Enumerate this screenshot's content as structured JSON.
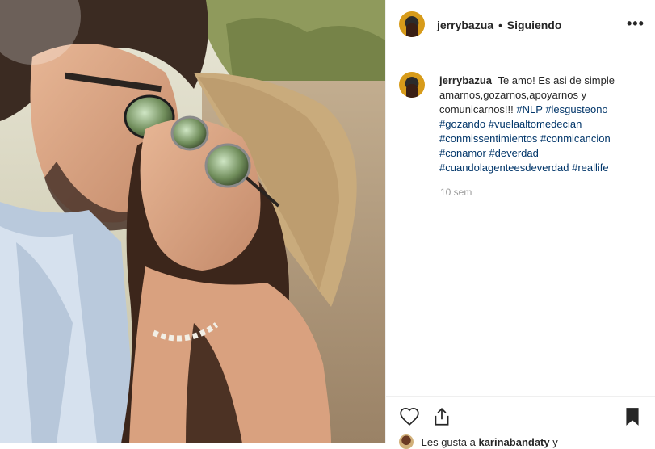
{
  "post": {
    "username": "jerrybazua",
    "separator": "•",
    "follow_status": "Siguiendo",
    "more_icon": "more-horizontal-icon",
    "more_label": "•••"
  },
  "caption": {
    "username": "jerrybazua",
    "text": "Te amo! Es asi de simple amarnos,gozarnos,apoyarnos y comunicarnos!!!",
    "hashtags": [
      "#NLP",
      "#lesgusteono",
      "#gozando",
      "#vuelaaltomedecian",
      "#conmissentimientos",
      "#conmicancion",
      "#conamor",
      "#deverdad",
      "#cuandolagenteesdeverdad",
      "#reallife"
    ],
    "time_ago": "10 sem"
  },
  "actions": {
    "like_icon": "heart-icon",
    "share_icon": "share-icon",
    "save_icon": "bookmark-icon"
  },
  "likes": {
    "prefix": "Les gusta a",
    "user": "karinabandaty",
    "suffix": "y"
  },
  "colors": {
    "hashtag": "#003569",
    "muted": "#999999",
    "text": "#262626",
    "border": "#efefef"
  }
}
